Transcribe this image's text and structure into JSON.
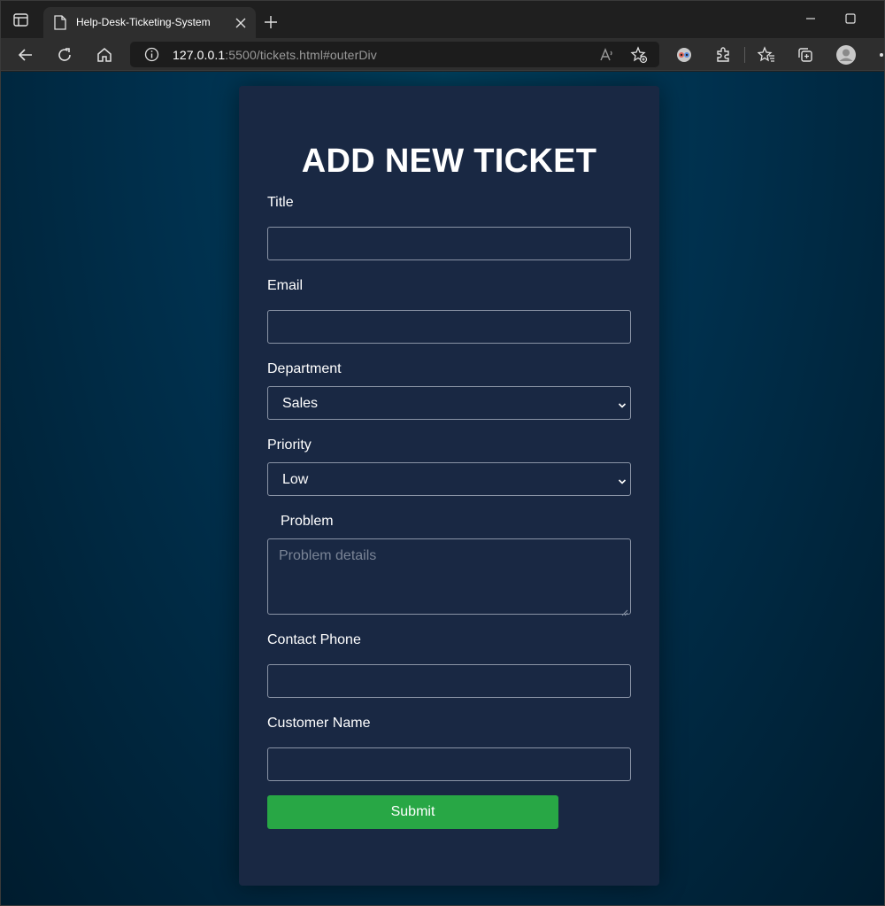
{
  "browser": {
    "tab_title": "Help-Desk-Ticketing-System",
    "url_host": "127.0.0.1",
    "url_rest": ":5500/tickets.html#outerDiv"
  },
  "form": {
    "heading": "ADD NEW TICKET",
    "title_label": "Title",
    "title_value": "",
    "email_label": "Email",
    "email_value": "",
    "department_label": "Department",
    "department_value": "Sales",
    "priority_label": "Priority",
    "priority_value": "Low",
    "problem_label": "Problem",
    "problem_placeholder": "Problem details",
    "phone_label": "Contact Phone",
    "phone_value": "",
    "customer_label": "Customer Name",
    "customer_value": "",
    "submit_label": "Submit"
  },
  "colors": {
    "card_bg": "#192843",
    "submit_bg": "#28a745",
    "page_bg": "#00304d"
  },
  "icons": {
    "tab_favicon": "page-icon",
    "back": "back-arrow-icon",
    "reload": "reload-icon",
    "home": "home-icon",
    "info": "info-icon",
    "read_aloud": "read-aloud-icon",
    "add_favorite": "add-favorite-icon",
    "extension_1": "extension-app-icon",
    "extensions": "puzzle-icon",
    "favorites": "favorites-icon",
    "collections": "collections-icon",
    "profile": "profile-icon"
  }
}
